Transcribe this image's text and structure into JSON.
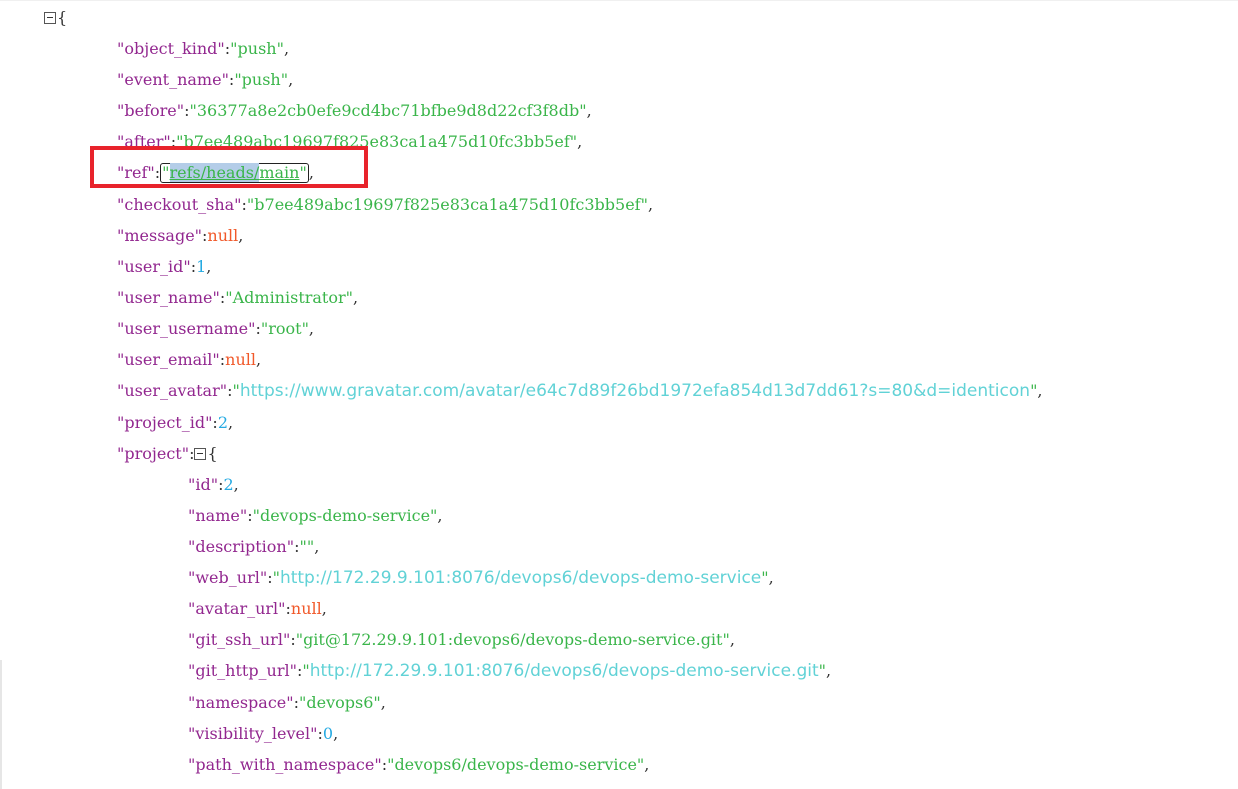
{
  "json_viewer": {
    "open_brace": "{",
    "project_open_brace": "{",
    "lines": [
      {
        "key": "object_kind",
        "value": "push",
        "type": "string"
      },
      {
        "key": "event_name",
        "value": "push",
        "type": "string"
      },
      {
        "key": "before",
        "value": "36377a8e2cb0efe9cd4bc71bfbe9d8d22cf3f8db",
        "type": "string"
      },
      {
        "key": "after",
        "value": "b7ee489abc19697f825e83ca1a475d10fc3bb5ef",
        "type": "string"
      },
      {
        "key": "ref",
        "value": "refs/heads/main",
        "value_selected": "refs/heads/",
        "value_rest": "main",
        "type": "string"
      },
      {
        "key": "checkout_sha",
        "value": "b7ee489abc19697f825e83ca1a475d10fc3bb5ef",
        "type": "string"
      },
      {
        "key": "message",
        "value": "null",
        "type": "null"
      },
      {
        "key": "user_id",
        "value": "1",
        "type": "number"
      },
      {
        "key": "user_name",
        "value": "Administrator",
        "type": "string"
      },
      {
        "key": "user_username",
        "value": "root",
        "type": "string"
      },
      {
        "key": "user_email",
        "value": "null",
        "type": "null"
      },
      {
        "key": "user_avatar",
        "value": "https://www.gravatar.com/avatar/e64c7d89f26bd1972efa854d13d7dd61?s=80&d=identicon",
        "type": "url"
      },
      {
        "key": "project_id",
        "value": "2",
        "type": "number"
      },
      {
        "key": "project",
        "type": "object"
      }
    ],
    "project_lines": [
      {
        "key": "id",
        "value": "2",
        "type": "number"
      },
      {
        "key": "name",
        "value": "devops-demo-service",
        "type": "string"
      },
      {
        "key": "description",
        "value": "",
        "type": "string"
      },
      {
        "key": "web_url",
        "value": "http://172.29.9.101:8076/devops6/devops-demo-service",
        "type": "url"
      },
      {
        "key": "avatar_url",
        "value": "null",
        "type": "null"
      },
      {
        "key": "git_ssh_url",
        "value": "git@172.29.9.101:devops6/devops-demo-service.git",
        "type": "string"
      },
      {
        "key": "git_http_url",
        "value": "http://172.29.9.101:8076/devops6/devops-demo-service.git",
        "type": "url"
      },
      {
        "key": "namespace",
        "value": "devops6",
        "type": "string"
      },
      {
        "key": "visibility_level",
        "value": "0",
        "type": "number"
      },
      {
        "key": "path_with_namespace",
        "value": "devops6/devops-demo-service",
        "type": "string"
      }
    ]
  },
  "colors": {
    "key": "#92278f",
    "string": "#3ab54a",
    "number": "#25aae2",
    "null": "#f1592a",
    "url": "#61d2d6",
    "highlight_box": "#e8232b",
    "selection": "#b4cde8"
  },
  "icons": {
    "collapse_toggle": "minus-square-icon"
  }
}
